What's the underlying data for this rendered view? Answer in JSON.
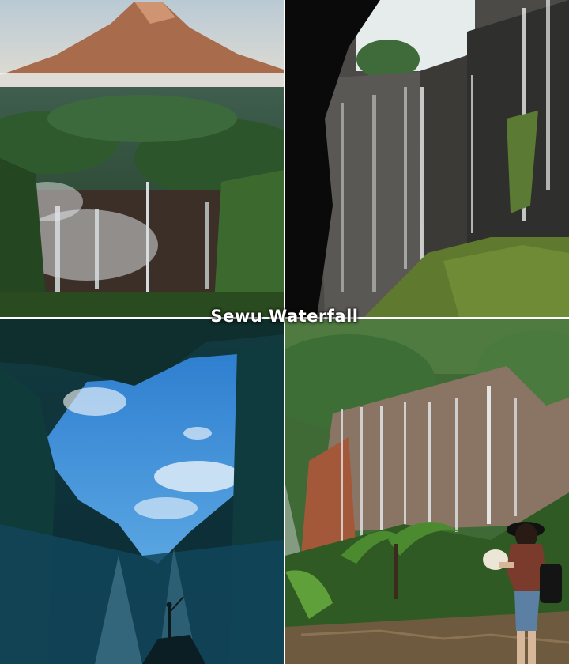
{
  "title": "Sewu Waterfall",
  "panels": [
    {
      "id": "volcano-valley",
      "subject": "volcano-above-forest-waterfalls"
    },
    {
      "id": "cliff-falls",
      "subject": "cliff-waterfalls-from-cave"
    },
    {
      "id": "heart-cave",
      "subject": "heart-shaped-sky-opening"
    },
    {
      "id": "hiker-view",
      "subject": "hiker-overlooking-falls"
    }
  ]
}
